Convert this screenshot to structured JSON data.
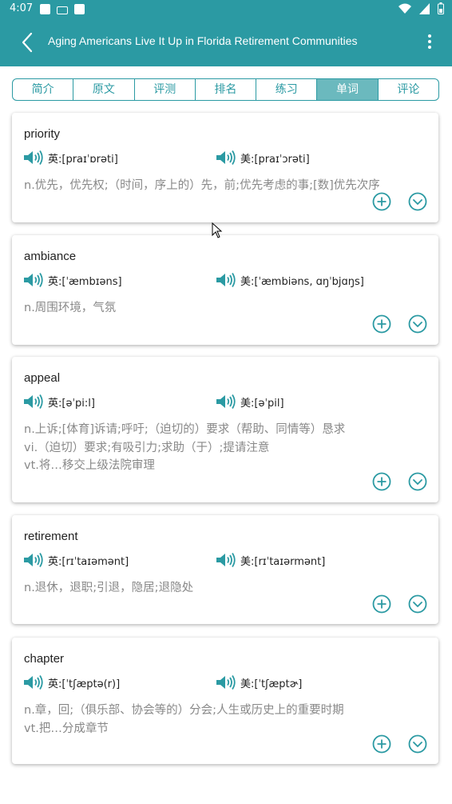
{
  "status": {
    "time": "4:07"
  },
  "header": {
    "title": "Aging Americans Live It Up in Florida Retirement Communities"
  },
  "tabs": [
    "简介",
    "原文",
    "评测",
    "排名",
    "练习",
    "单词",
    "评论"
  ],
  "active_tab": "单词",
  "colors": {
    "primary": "#2b9aa3",
    "tab_active": "#6bb9be",
    "definition_text": "#888888"
  },
  "words": [
    {
      "word": "priority",
      "uk": "英:[praɪˈɒrəti]",
      "us": "美:[praɪˈɔrəti]",
      "defs": [
        "n.优先，优先权;（时间，序上的）先，前;优先考虑的事;[数]优先次序"
      ]
    },
    {
      "word": "ambiance",
      "uk": "英:[ˈæmbɪəns]",
      "us": "美:[ˈæmbiəns, ɑŋˈbjɑŋs]",
      "defs": [
        "n.周围环境，气氛"
      ]
    },
    {
      "word": "appeal",
      "uk": "英:[əˈpi:l]",
      "us": "美:[əˈpil]",
      "defs": [
        "n.上诉;[体育]诉请;呼吁;（迫切的）要求（帮助、同情等）恳求",
        "vi.（迫切）要求;有吸引力;求助（于）;提请注意",
        "vt.将…移交上级法院审理"
      ]
    },
    {
      "word": "retirement",
      "uk": "英:[rɪˈtaɪəmənt]",
      "us": "美:[rɪˈtaɪərmənt]",
      "defs": [
        "n.退休，退职;引退，隐居;退隐处"
      ]
    },
    {
      "word": "chapter",
      "uk": "英:[ˈtʃæptə(r)]",
      "us": "美:[ˈtʃæptɚ]",
      "defs": [
        "n.章，回;（俱乐部、协会等的）分会;人生或历史上的重要时期",
        "vt.把…分成章节"
      ]
    }
  ],
  "icons": {
    "back": "arrow-left-icon",
    "menu": "more-vert-icon",
    "speaker": "speaker-icon",
    "add": "add-circle-icon",
    "expand": "expand-circle-icon"
  }
}
